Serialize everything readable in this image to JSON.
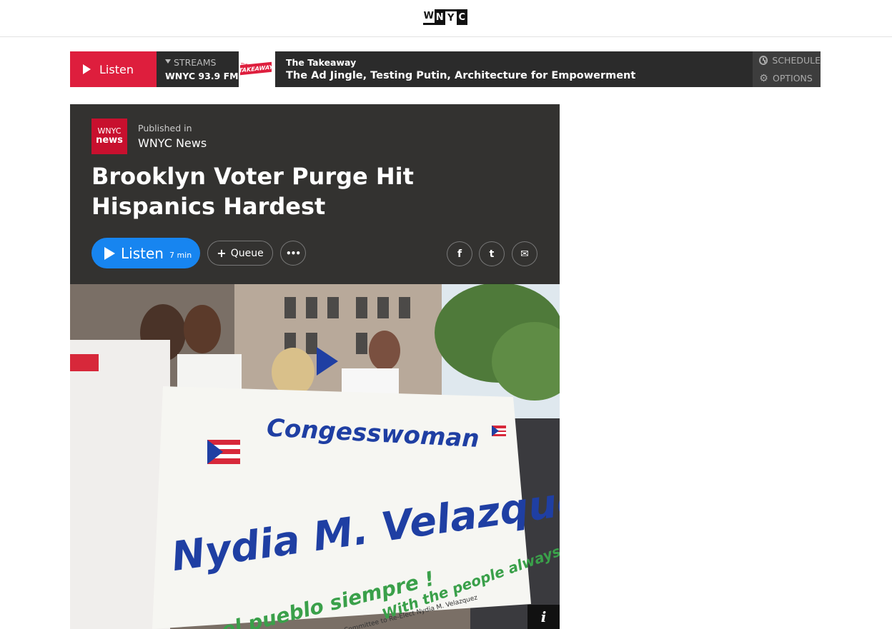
{
  "site": {
    "logo_letters": [
      "W",
      "N",
      "Y",
      "C"
    ]
  },
  "player": {
    "listen_label": "Listen",
    "streams_label": "STREAMS",
    "station": "WNYC 93.9 FM",
    "show_logo_text": "TAKEAWAY",
    "show_logo_prefix": "The",
    "show_name": "The Takeaway",
    "episode_title": "The Ad Jingle, Testing Putin, Architecture for Empowerment",
    "schedule_label": "SCHEDULE",
    "options_label": "OPTIONS",
    "accent_color": "#de1e3d"
  },
  "article": {
    "publisher_logo_line1": "WNYC",
    "publisher_logo_line2": "news",
    "published_in_label": "Published in",
    "publisher_name": "WNYC News",
    "headline": "Brooklyn Voter Purge Hit Hispanics Hardest",
    "listen_label": "Listen",
    "duration": "7 min",
    "queue_label": "Queue",
    "more_label": "•••",
    "share": {
      "facebook": "f",
      "twitter": "t",
      "email": "✉"
    },
    "image_info_label": "i",
    "listen_color": "#1785f0"
  },
  "banner": {
    "line1": "Congesswoman",
    "line2": "Nydia M. Velazquez",
    "line3": "With the people always !",
    "line4": "Con el pueblo siempre !",
    "fine_print": "Paid for by Committee to Re-Elect Nydia M. Velazquez"
  }
}
